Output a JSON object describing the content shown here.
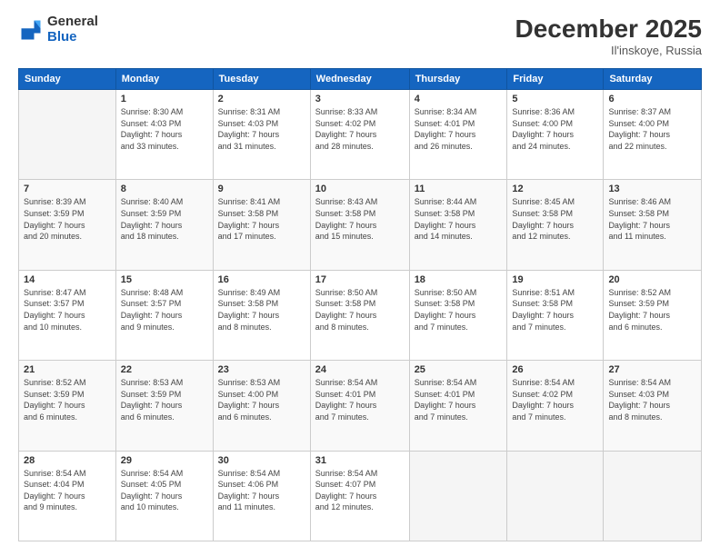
{
  "header": {
    "logo_general": "General",
    "logo_blue": "Blue",
    "month_title": "December 2025",
    "location": "Il'inskoye, Russia"
  },
  "days_of_week": [
    "Sunday",
    "Monday",
    "Tuesday",
    "Wednesday",
    "Thursday",
    "Friday",
    "Saturday"
  ],
  "weeks": [
    [
      {
        "day": "",
        "info": ""
      },
      {
        "day": "1",
        "info": "Sunrise: 8:30 AM\nSunset: 4:03 PM\nDaylight: 7 hours\nand 33 minutes."
      },
      {
        "day": "2",
        "info": "Sunrise: 8:31 AM\nSunset: 4:03 PM\nDaylight: 7 hours\nand 31 minutes."
      },
      {
        "day": "3",
        "info": "Sunrise: 8:33 AM\nSunset: 4:02 PM\nDaylight: 7 hours\nand 28 minutes."
      },
      {
        "day": "4",
        "info": "Sunrise: 8:34 AM\nSunset: 4:01 PM\nDaylight: 7 hours\nand 26 minutes."
      },
      {
        "day": "5",
        "info": "Sunrise: 8:36 AM\nSunset: 4:00 PM\nDaylight: 7 hours\nand 24 minutes."
      },
      {
        "day": "6",
        "info": "Sunrise: 8:37 AM\nSunset: 4:00 PM\nDaylight: 7 hours\nand 22 minutes."
      }
    ],
    [
      {
        "day": "7",
        "info": "Sunrise: 8:39 AM\nSunset: 3:59 PM\nDaylight: 7 hours\nand 20 minutes."
      },
      {
        "day": "8",
        "info": "Sunrise: 8:40 AM\nSunset: 3:59 PM\nDaylight: 7 hours\nand 18 minutes."
      },
      {
        "day": "9",
        "info": "Sunrise: 8:41 AM\nSunset: 3:58 PM\nDaylight: 7 hours\nand 17 minutes."
      },
      {
        "day": "10",
        "info": "Sunrise: 8:43 AM\nSunset: 3:58 PM\nDaylight: 7 hours\nand 15 minutes."
      },
      {
        "day": "11",
        "info": "Sunrise: 8:44 AM\nSunset: 3:58 PM\nDaylight: 7 hours\nand 14 minutes."
      },
      {
        "day": "12",
        "info": "Sunrise: 8:45 AM\nSunset: 3:58 PM\nDaylight: 7 hours\nand 12 minutes."
      },
      {
        "day": "13",
        "info": "Sunrise: 8:46 AM\nSunset: 3:58 PM\nDaylight: 7 hours\nand 11 minutes."
      }
    ],
    [
      {
        "day": "14",
        "info": "Sunrise: 8:47 AM\nSunset: 3:57 PM\nDaylight: 7 hours\nand 10 minutes."
      },
      {
        "day": "15",
        "info": "Sunrise: 8:48 AM\nSunset: 3:57 PM\nDaylight: 7 hours\nand 9 minutes."
      },
      {
        "day": "16",
        "info": "Sunrise: 8:49 AM\nSunset: 3:58 PM\nDaylight: 7 hours\nand 8 minutes."
      },
      {
        "day": "17",
        "info": "Sunrise: 8:50 AM\nSunset: 3:58 PM\nDaylight: 7 hours\nand 8 minutes."
      },
      {
        "day": "18",
        "info": "Sunrise: 8:50 AM\nSunset: 3:58 PM\nDaylight: 7 hours\nand 7 minutes."
      },
      {
        "day": "19",
        "info": "Sunrise: 8:51 AM\nSunset: 3:58 PM\nDaylight: 7 hours\nand 7 minutes."
      },
      {
        "day": "20",
        "info": "Sunrise: 8:52 AM\nSunset: 3:59 PM\nDaylight: 7 hours\nand 6 minutes."
      }
    ],
    [
      {
        "day": "21",
        "info": "Sunrise: 8:52 AM\nSunset: 3:59 PM\nDaylight: 7 hours\nand 6 minutes."
      },
      {
        "day": "22",
        "info": "Sunrise: 8:53 AM\nSunset: 3:59 PM\nDaylight: 7 hours\nand 6 minutes."
      },
      {
        "day": "23",
        "info": "Sunrise: 8:53 AM\nSunset: 4:00 PM\nDaylight: 7 hours\nand 6 minutes."
      },
      {
        "day": "24",
        "info": "Sunrise: 8:54 AM\nSunset: 4:01 PM\nDaylight: 7 hours\nand 7 minutes."
      },
      {
        "day": "25",
        "info": "Sunrise: 8:54 AM\nSunset: 4:01 PM\nDaylight: 7 hours\nand 7 minutes."
      },
      {
        "day": "26",
        "info": "Sunrise: 8:54 AM\nSunset: 4:02 PM\nDaylight: 7 hours\nand 7 minutes."
      },
      {
        "day": "27",
        "info": "Sunrise: 8:54 AM\nSunset: 4:03 PM\nDaylight: 7 hours\nand 8 minutes."
      }
    ],
    [
      {
        "day": "28",
        "info": "Sunrise: 8:54 AM\nSunset: 4:04 PM\nDaylight: 7 hours\nand 9 minutes."
      },
      {
        "day": "29",
        "info": "Sunrise: 8:54 AM\nSunset: 4:05 PM\nDaylight: 7 hours\nand 10 minutes."
      },
      {
        "day": "30",
        "info": "Sunrise: 8:54 AM\nSunset: 4:06 PM\nDaylight: 7 hours\nand 11 minutes."
      },
      {
        "day": "31",
        "info": "Sunrise: 8:54 AM\nSunset: 4:07 PM\nDaylight: 7 hours\nand 12 minutes."
      },
      {
        "day": "",
        "info": ""
      },
      {
        "day": "",
        "info": ""
      },
      {
        "day": "",
        "info": ""
      }
    ]
  ]
}
